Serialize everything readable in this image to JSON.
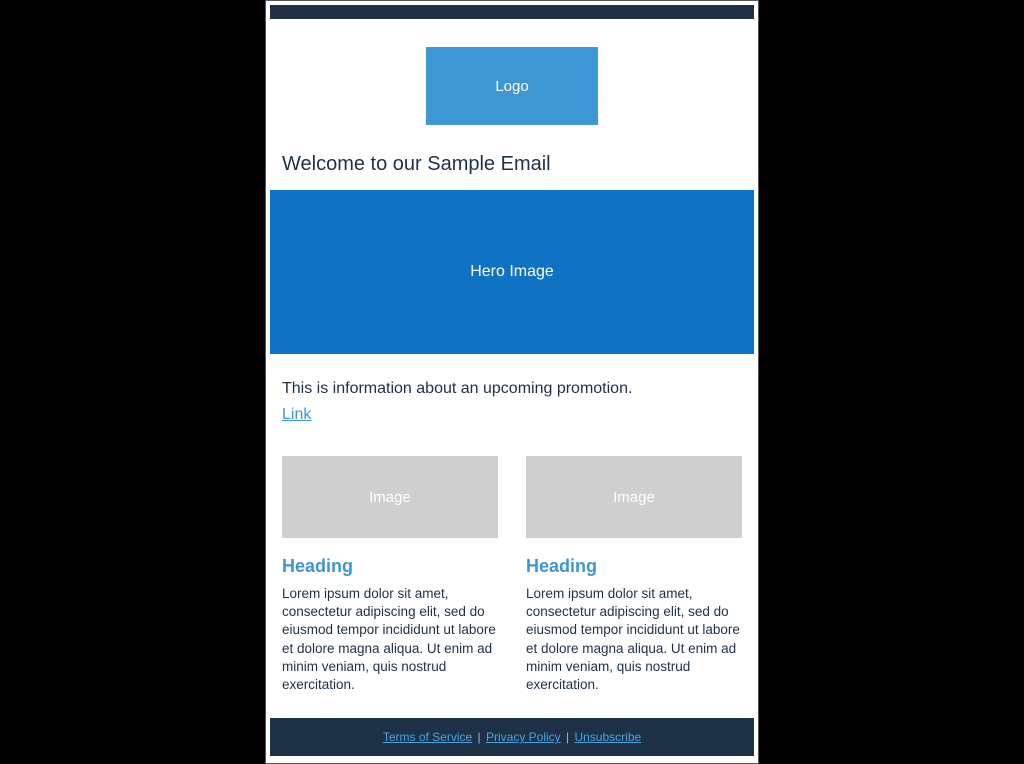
{
  "colors": {
    "dark": "#1e3147",
    "accent_light": "#3d97d3",
    "hero": "#0f72c2",
    "placeholder_gray": "#cfcfcf"
  },
  "header": {
    "logo_label": "Logo"
  },
  "welcome_heading": "Welcome to our Sample Email",
  "hero": {
    "label": "Hero Image"
  },
  "promo": {
    "text": "This is information about an upcoming promotion.",
    "link_label": "Link"
  },
  "columns": [
    {
      "image_label": "Image",
      "heading": "Heading",
      "body": "Lorem ipsum dolor sit amet, consectetur adipiscing elit, sed do eiusmod tempor incididunt ut labore et dolore magna aliqua. Ut enim ad minim veniam, quis nostrud exercitation."
    },
    {
      "image_label": "Image",
      "heading": "Heading",
      "body": "Lorem ipsum dolor sit amet, consectetur adipiscing elit, sed do eiusmod tempor incididunt ut labore et dolore magna aliqua. Ut enim ad minim veniam, quis nostrud exercitation."
    }
  ],
  "footer": {
    "terms": "Terms of Service",
    "privacy": "Privacy Policy",
    "unsubscribe": "Unsubscribe",
    "separator": " | "
  }
}
